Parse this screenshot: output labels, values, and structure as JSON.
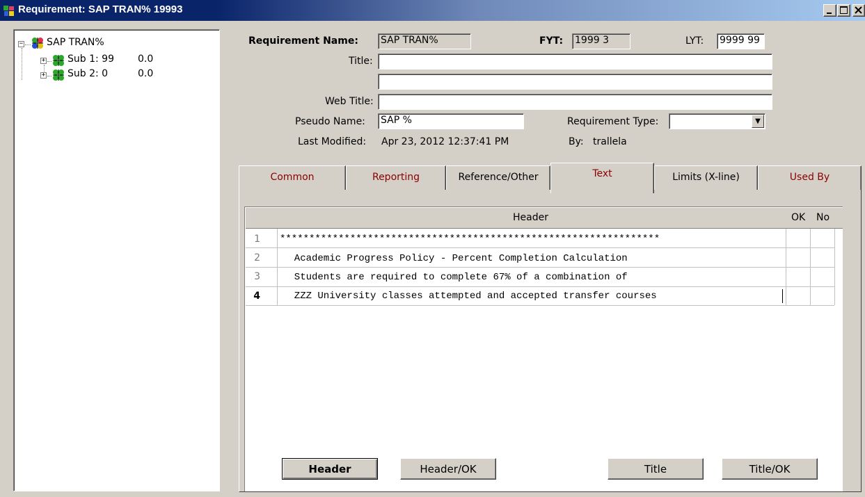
{
  "window": {
    "title": "Requirement: SAP TRAN% 19993"
  },
  "tree": {
    "root_label": "SAP TRAN%",
    "children": [
      {
        "label": "Sub 1: 99",
        "value": "0.0"
      },
      {
        "label": "Sub 2:  0",
        "value": "0.0"
      }
    ]
  },
  "form": {
    "requirement_name_label": "Requirement Name:",
    "requirement_name_value": "SAP TRAN%",
    "fyt_label": "FYT:",
    "fyt_value": "1999 3",
    "lyt_label": "LYT:",
    "lyt_value": "9999 99",
    "title_label": "Title:",
    "title_value_1": "",
    "title_value_2": "",
    "web_title_label": "Web Title:",
    "web_title_value": "",
    "pseudo_name_label": "Pseudo Name:",
    "pseudo_name_value": "SAP %",
    "requirement_type_label": "Requirement Type:",
    "requirement_type_value": "",
    "last_modified_label": "Last Modified:",
    "last_modified_value": "Apr 23, 2012  12:37:41 PM",
    "by_label": "By:",
    "by_value": "trallela"
  },
  "tabs": [
    {
      "label": "Common",
      "color": "#8b0000"
    },
    {
      "label": "Reporting",
      "color": "#8b0000"
    },
    {
      "label": "Reference/Other",
      "color": "#000000"
    },
    {
      "label": "Text",
      "color": "#8b0000",
      "active": true
    },
    {
      "label": "Limits (X-line)",
      "color": "#000000"
    },
    {
      "label": "Used By",
      "color": "#8b0000"
    }
  ],
  "grid": {
    "columns": [
      "Header",
      "OK",
      "No"
    ],
    "rows": [
      {
        "num": "1",
        "text": "*****************************************************************"
      },
      {
        "num": "2",
        "text": "  Academic Progress Policy - Percent Completion Calculation"
      },
      {
        "num": "3",
        "text": "  Students are required to complete 67% of a combination of"
      },
      {
        "num": "4",
        "text": "  ZZZ University classes attempted and accepted transfer courses"
      }
    ]
  },
  "buttons": {
    "header": "Header",
    "header_ok": "Header/OK",
    "title": "Title",
    "title_ok": "Title/OK"
  },
  "icons": {
    "tree_node": "puzzle-people-icon",
    "expand": "plus-box-icon",
    "collapse": "minus-box-icon"
  }
}
